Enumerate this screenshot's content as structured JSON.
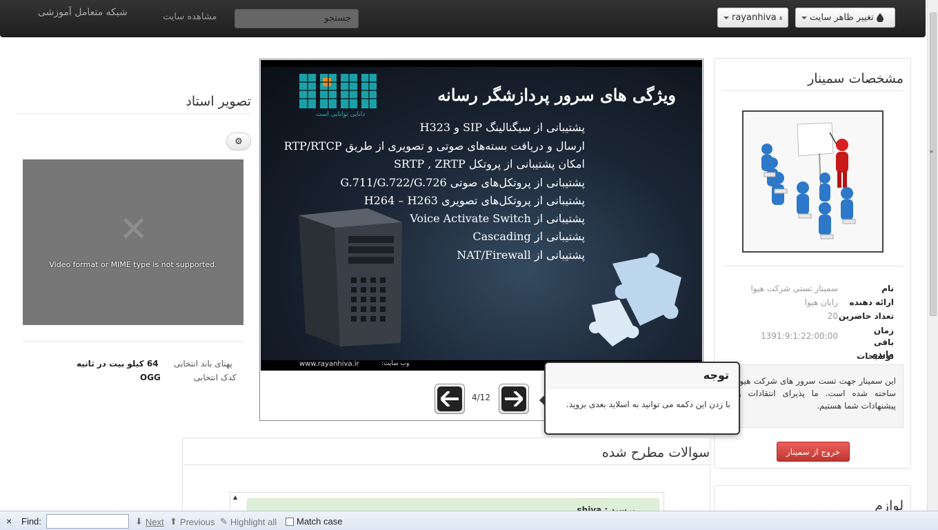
{
  "navbar": {
    "brand": "شبکه متعامل آموزشی",
    "view_site": "مشاهده سایت",
    "search_placeholder": "جستجو",
    "user_button": "rayanhiva",
    "theme_button": "تغییر ظاهر سایت"
  },
  "seminar_panel": {
    "title": "مشخصات سمینار",
    "fields": [
      {
        "label": "نام",
        "value": "سمینار تستی شرکت هیوا"
      },
      {
        "label": "ارائه دهنده",
        "value": "رایان هیوا"
      },
      {
        "label": "تعداد حاضرین",
        "value": "20"
      },
      {
        "label": "زمان باقی مانده",
        "value": "1391:9:1:22:00:00"
      },
      {
        "label": "توضیحات",
        "value": ""
      }
    ],
    "description": "این سمینار جهت تست سرور های شرکت هیوا ساخته شده است. ما پذیرای انتقادات و پیشنهادات شما هستیم.",
    "exit_button": "خروج از سمینار"
  },
  "accessories_panel": {
    "title": "لوازم"
  },
  "slide": {
    "title": "ویژگی های سرور پردازشگر رسانه",
    "logo_caption": "دانایی توانایی است",
    "lines": [
      "پشتیبانی از سیگنالینگ SIP و H323",
      "ارسال و دریافت بسته‌های صوتی و تصویری از طریق RTP/RTCP",
      "امکان پشتیبانی از پروتکل SRTP , ZRTP",
      "پشتیبانی از پروتکل‌های صوتی G.711/G.722/G.726",
      "پشتیبانی از پروتکل‌های تصویری H264 – H263",
      "پشتیبانی از Voice Activate Switch",
      "پشتیبانی از Cascading",
      "پشتیبانی از NAT/Firewall"
    ],
    "footer_url": "www.rayanhiva.ir",
    "footer_label": "وب سایت:",
    "page_indicator": "4/12"
  },
  "popover": {
    "title": "توجه",
    "body": "با زدن این دکمه می توانید به اسلاید بعدی بروید."
  },
  "teacher": {
    "title": "تصویر استاد",
    "video_error": "Video format or MIME type is not supported.",
    "bandwidth_label": "پهنای باند انتخابی",
    "bandwidth_value": "64 کیلو بیت در ثانیه",
    "codec_label": "کدک انتخابی",
    "codec_value": "OGG"
  },
  "questions": {
    "title": "سوالات مطرح شده",
    "items": [
      {
        "asker": "shiva",
        "asker_suffix": "پرسید :"
      }
    ]
  },
  "findbar": {
    "close": "×",
    "find_label": "Find:",
    "next": "Next",
    "previous": "Previous",
    "highlight_all": "Highlight all",
    "match_case": "Match case"
  },
  "colors": {
    "navbar": "#222222",
    "exit_button": "#bd362f",
    "question_bg": "#dff0d8",
    "slide_bg": "#0b0f16"
  }
}
